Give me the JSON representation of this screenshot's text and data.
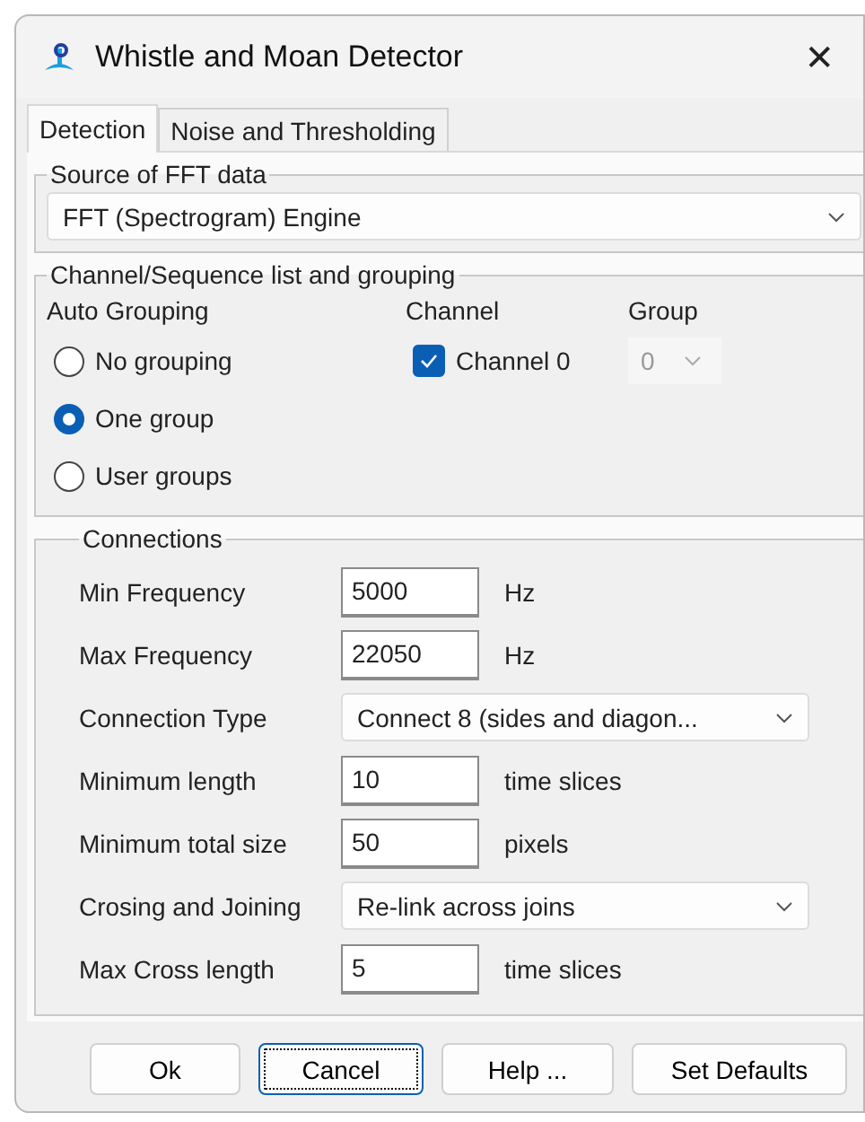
{
  "window": {
    "title": "Whistle and Moan Detector",
    "close": "✕"
  },
  "tabs": [
    {
      "label": "Detection",
      "selected": true
    },
    {
      "label": "Noise and Thresholding",
      "selected": false
    }
  ],
  "source": {
    "legend": "Source of FFT data",
    "value": "FFT (Spectrogram) Engine"
  },
  "grouping": {
    "legend": "Channel/Sequence list and grouping",
    "auto_label": "Auto Grouping",
    "channel_label": "Channel",
    "group_label": "Group",
    "options": [
      {
        "label": "No grouping",
        "selected": false
      },
      {
        "label": "One group",
        "selected": true
      },
      {
        "label": "User groups",
        "selected": false
      }
    ],
    "channels": [
      {
        "label": "Channel 0",
        "checked": true,
        "group": "0",
        "group_disabled": true
      }
    ]
  },
  "connections": {
    "legend": "Connections",
    "rows": [
      {
        "kind": "text",
        "label": "Min Frequency",
        "value": "5000",
        "unit": "Hz"
      },
      {
        "kind": "text",
        "label": "Max Frequency",
        "value": "22050",
        "unit": "Hz"
      },
      {
        "kind": "select",
        "label": "Connection Type",
        "value": "Connect 8 (sides and diagon..."
      },
      {
        "kind": "text",
        "label": "Minimum length",
        "value": "10",
        "unit": "time slices"
      },
      {
        "kind": "text",
        "label": "Minimum total size",
        "value": "50",
        "unit": "pixels"
      },
      {
        "kind": "select",
        "label": "Crosing and Joining",
        "value": "Re-link across joins"
      },
      {
        "kind": "text",
        "label": "Max Cross length",
        "value": "5",
        "unit": "time slices"
      }
    ]
  },
  "buttons": [
    {
      "label": "Ok",
      "focused": false
    },
    {
      "label": "Cancel",
      "focused": true
    },
    {
      "label": "Help ...",
      "focused": false
    },
    {
      "label": "Set Defaults",
      "focused": false
    }
  ]
}
